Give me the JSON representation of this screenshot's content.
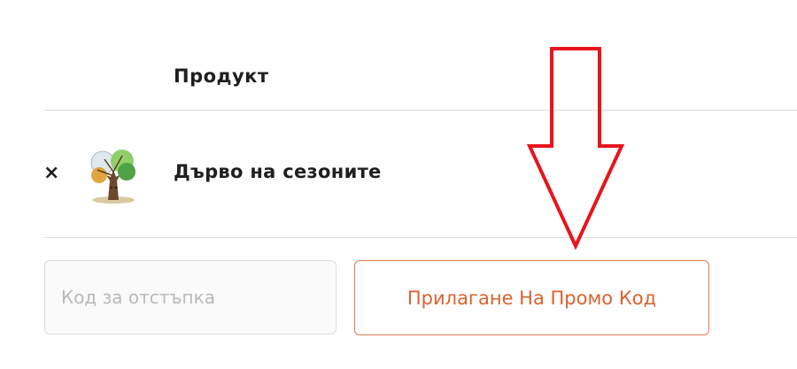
{
  "cart": {
    "column_header": "Продукт",
    "items": [
      {
        "remove_label": "×",
        "thumbnail_icon": "tree-of-seasons-thumbnail",
        "name": "Дърво на сезоните"
      }
    ]
  },
  "coupon": {
    "placeholder": "Код за отстъпка",
    "value": "",
    "apply_label": "Прилагане На Промо Код"
  },
  "annotation": {
    "icon": "red-down-arrow-icon",
    "color": "#e8141c"
  },
  "colors": {
    "accent": "#d9622f",
    "accent_border": "#e07a4f",
    "text": "#1f1f1f",
    "divider": "#dcdcdc"
  }
}
